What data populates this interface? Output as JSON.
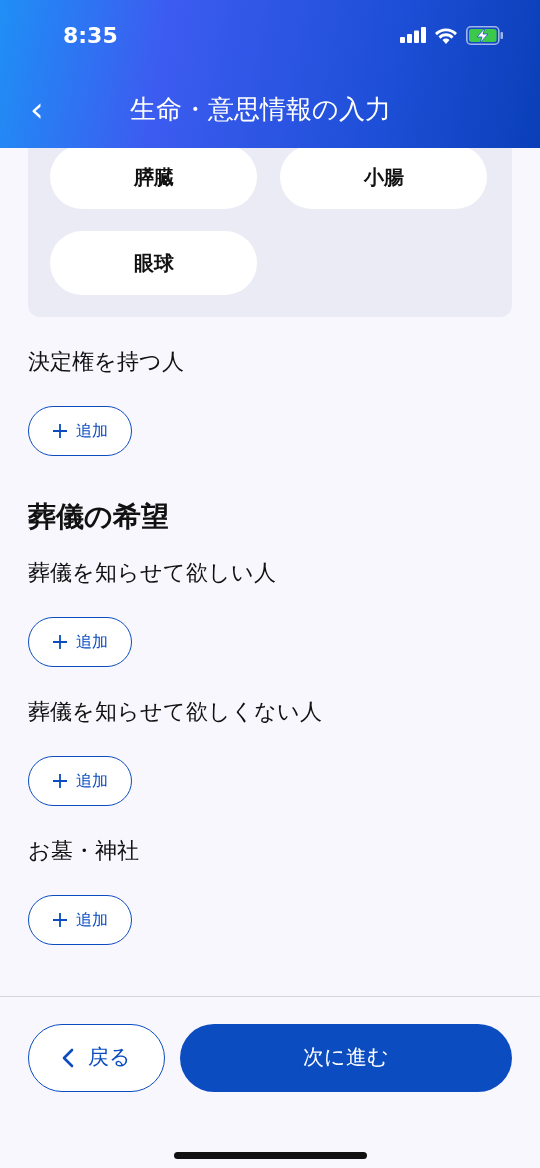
{
  "status_bar": {
    "time": "8:35"
  },
  "header": {
    "back": "‹",
    "title": "生命・意思情報の入力"
  },
  "organs": [
    "膵臓",
    "小腸",
    "眼球"
  ],
  "sections": [
    {
      "kind": "field",
      "label": "決定権を持つ人",
      "add_button": "追加"
    },
    {
      "kind": "heading",
      "label": "葬儀の希望"
    },
    {
      "kind": "field",
      "label": "葬儀を知らせて欲しい人",
      "add_button": "追加"
    },
    {
      "kind": "field",
      "label": "葬儀を知らせて欲しくない人",
      "add_button": "追加"
    },
    {
      "kind": "field",
      "label": "お墓・神社",
      "add_button": "追加"
    }
  ],
  "footer": {
    "back_button": "戻る",
    "next_button": "次に進む"
  }
}
